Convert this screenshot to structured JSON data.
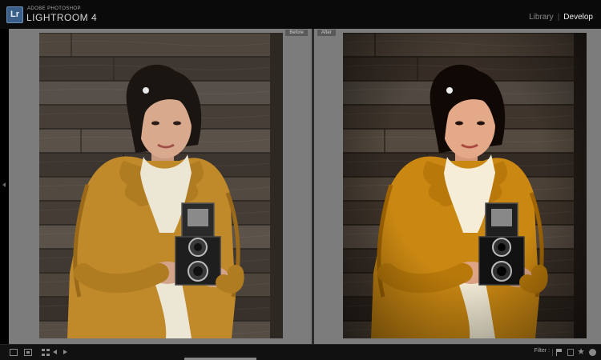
{
  "app": {
    "logo_text": "Lr",
    "vendor": "ADOBE PHOTOSHOP",
    "name": "LIGHTROOM 4"
  },
  "modules": {
    "library": "Library",
    "separator": "|",
    "develop": "Develop",
    "active": "Develop"
  },
  "view": {
    "before_label": "Before",
    "after_label": "After"
  },
  "filmstrip": {
    "filter_label": "Filter :",
    "icons": [
      "single-view-icon",
      "second-window-icon",
      "grid-view-icon",
      "previous-arrow-icon",
      "next-arrow-icon",
      "flag-icon",
      "unflagged-icon",
      "star-icon",
      "color-label-icon"
    ]
  },
  "colors": {
    "chrome": "#0a0a0a",
    "panel_gray": "#7c7c7c",
    "wood": "#4a4038",
    "coat": "#c08a2a",
    "scarf": "#ece6d4",
    "hair": "#1b1512",
    "skin": "#d9a98e",
    "camera": "#2a2a2a"
  }
}
